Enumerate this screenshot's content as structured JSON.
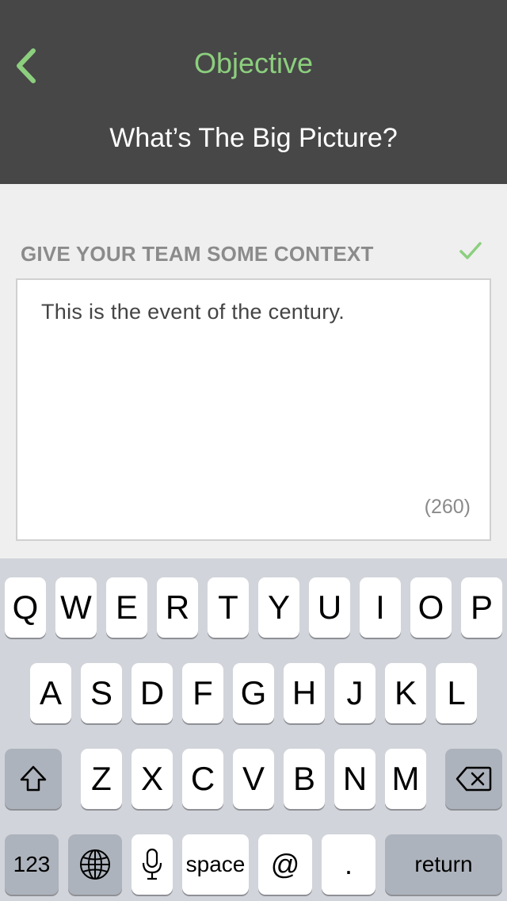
{
  "header": {
    "title": "Objective",
    "subtitle": "What’s The Big Picture?"
  },
  "section": {
    "label": "GIVE YOUR TEAM SOME CONTEXT"
  },
  "context_input": {
    "value": "This is the event of the century.",
    "char_count": "(260)"
  },
  "keyboard": {
    "row1": [
      "Q",
      "W",
      "E",
      "R",
      "T",
      "Y",
      "U",
      "I",
      "O",
      "P"
    ],
    "row2": [
      "A",
      "S",
      "D",
      "F",
      "G",
      "H",
      "J",
      "K",
      "L"
    ],
    "row3": [
      "Z",
      "X",
      "C",
      "V",
      "B",
      "N",
      "M"
    ],
    "numbers_label": "123",
    "space_label": "space",
    "at_label": "@",
    "period_label": ".",
    "return_label": "return"
  },
  "colors": {
    "header_bg": "#474747",
    "accent": "#8ccf7e",
    "keyboard_bg": "#d1d4da"
  },
  "icons": {
    "back": "chevron-left-icon",
    "check": "check-icon",
    "shift": "shift-icon",
    "delete": "backspace-icon",
    "globe": "globe-icon",
    "mic": "microphone-icon"
  }
}
